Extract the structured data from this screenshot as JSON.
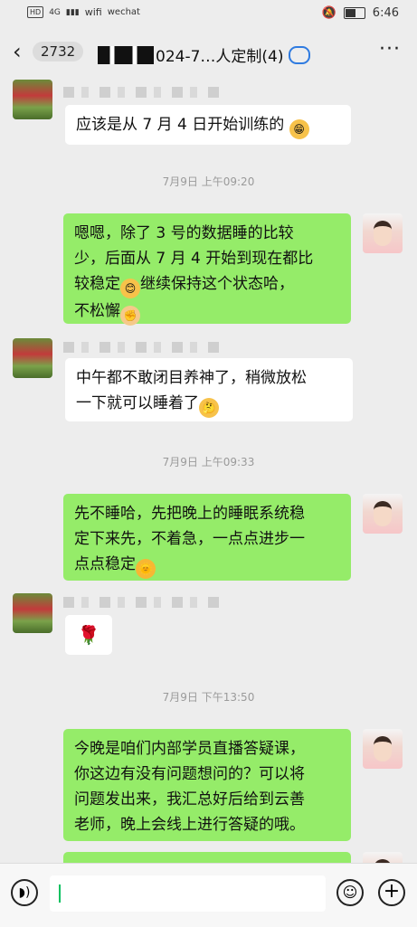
{
  "status_bar": {
    "left_items": [
      "HD",
      "4G",
      "▮▮▮",
      "wifi",
      "wechat"
    ],
    "time": "6:46"
  },
  "header": {
    "back_icon": "chevron-left-icon",
    "unread_count": "2732",
    "title": "024-7…人定制(4)",
    "more_icon": "more-icon"
  },
  "messages": [
    {
      "type": "incoming",
      "text": "应该是从 7 月 4 日开始训练的",
      "emoji": "grin"
    },
    {
      "type": "time",
      "text": "7月9日 上午09:20"
    },
    {
      "type": "outgoing",
      "text_lines": [
        "嗯嗯，除了 3 号的数据睡的比较",
        "少，后面从 7 月 4 开始到现在都比",
        "较稳定",
        "继续保持这个状态哈，",
        "不松懈"
      ]
    },
    {
      "type": "incoming",
      "text_lines": [
        "中午都不敢闭目养神了，稍微放松",
        "一下就可以睡着了"
      ]
    },
    {
      "type": "time",
      "text": "7月9日 上午09:33"
    },
    {
      "type": "outgoing",
      "text_lines": [
        "先不睡哈，先把晚上的睡眠系统稳",
        "定下来先，不着急，一点点进步一",
        "点点稳定"
      ]
    },
    {
      "type": "incoming",
      "text": "🌹"
    },
    {
      "type": "time",
      "text": "7月9日 下午13:50"
    },
    {
      "type": "outgoing",
      "text_lines": [
        "今晚是咱们内部学员直播答疑课，",
        "你这边有没有问题想问的？可以将",
        "问题发出来，我汇总好后给到云善",
        "老师，晚上会线上进行答疑的哦。"
      ]
    }
  ],
  "input_bar": {
    "voice_icon": "voice-icon",
    "emoji_icon": "emoji-icon",
    "plus_icon": "plus-icon"
  }
}
